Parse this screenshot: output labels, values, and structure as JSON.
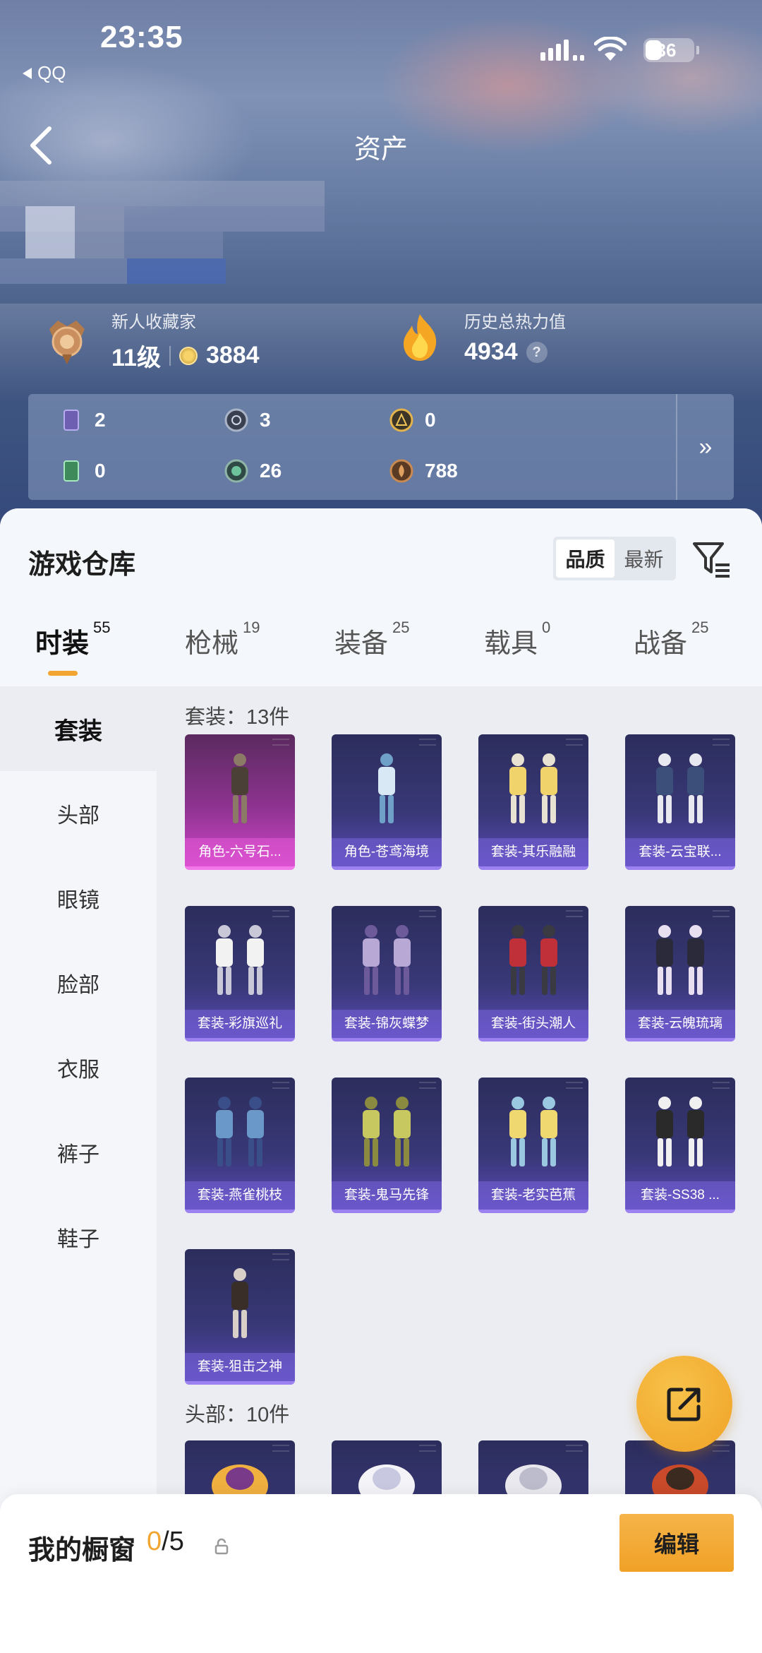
{
  "status_bar": {
    "time": "23:35",
    "back_app": "QQ",
    "battery": "36"
  },
  "nav": {
    "title": "资产"
  },
  "profile": {
    "collector_label": "新人收藏家",
    "level": "11级",
    "points": "3884",
    "history_label": "历史总热力值",
    "history_value": "4934",
    "help": "?"
  },
  "currencies": [
    {
      "icon": "purple-card-icon",
      "value": "2"
    },
    {
      "icon": "silver-badge-icon",
      "value": "3"
    },
    {
      "icon": "gold-badge-icon",
      "value": "0"
    },
    {
      "icon": "green-card-icon",
      "value": "0"
    },
    {
      "icon": "green-orb-icon",
      "value": "26"
    },
    {
      "icon": "bronze-coin-icon",
      "value": "788"
    }
  ],
  "currency_more": "»",
  "warehouse": {
    "title": "游戏仓库",
    "sort_options": [
      "品质",
      "最新"
    ],
    "sort_selected": "品质"
  },
  "tabs": [
    {
      "label": "时装",
      "count": "55"
    },
    {
      "label": "枪械",
      "count": "19"
    },
    {
      "label": "装备",
      "count": "25"
    },
    {
      "label": "载具",
      "count": "0"
    },
    {
      "label": "战备",
      "count": "25"
    }
  ],
  "sidebar": [
    "套装",
    "头部",
    "眼镜",
    "脸部",
    "衣服",
    "裤子",
    "鞋子"
  ],
  "sections": {
    "suits_title": "套装：13件",
    "head_title": "头部：10件"
  },
  "suits": [
    "角色-六号石...",
    "角色-苍鸢海境",
    "套装-其乐融融",
    "套装-云宝联...",
    "套装-彩旗巡礼",
    "套装-锦灰蝶梦",
    "套装-街头潮人",
    "套装-云魄琉璃",
    "套装-燕雀桃枝",
    "套装-鬼马先锋",
    "套装-老实芭蕉",
    "套装-SS38 ...",
    "套装-狙击之神"
  ],
  "showcase": {
    "title": "我的橱窗",
    "used": "0",
    "total": "/5",
    "edit_label": "编辑"
  },
  "colors": {
    "accent": "#f2a531",
    "card_purple": "#393878",
    "card_pink": "#8e3390"
  }
}
